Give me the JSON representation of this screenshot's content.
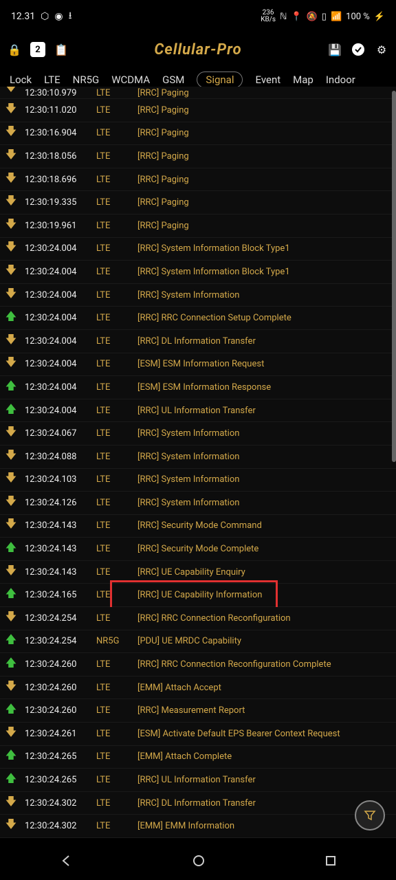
{
  "status": {
    "time": "12.31",
    "kbs_top": "236",
    "kbs_bot": "KB/s",
    "battery": "100 %"
  },
  "app": {
    "title": "Cellular-Pro",
    "badge": "2"
  },
  "tabs": [
    "Lock",
    "LTE",
    "NR5G",
    "WCDMA",
    "GSM",
    "Signal",
    "Event",
    "Map",
    "Indoor"
  ],
  "active_tab": "Signal",
  "log": [
    {
      "dir": "down",
      "time": "12:30:10.979",
      "tech": "LTE",
      "msg": "[RRC] Paging",
      "partial": true
    },
    {
      "dir": "down",
      "time": "12:30:11.020",
      "tech": "LTE",
      "msg": "[RRC] Paging"
    },
    {
      "dir": "down",
      "time": "12:30:16.904",
      "tech": "LTE",
      "msg": "[RRC] Paging"
    },
    {
      "dir": "down",
      "time": "12:30:18.056",
      "tech": "LTE",
      "msg": "[RRC] Paging"
    },
    {
      "dir": "down",
      "time": "12:30:18.696",
      "tech": "LTE",
      "msg": "[RRC] Paging"
    },
    {
      "dir": "down",
      "time": "12:30:19.335",
      "tech": "LTE",
      "msg": "[RRC] Paging"
    },
    {
      "dir": "down",
      "time": "12:30:19.961",
      "tech": "LTE",
      "msg": "[RRC] Paging"
    },
    {
      "dir": "down",
      "time": "12:30:24.004",
      "tech": "LTE",
      "msg": "[RRC] System Information Block Type1"
    },
    {
      "dir": "down",
      "time": "12:30:24.004",
      "tech": "LTE",
      "msg": "[RRC] System Information Block Type1"
    },
    {
      "dir": "down",
      "time": "12:30:24.004",
      "tech": "LTE",
      "msg": "[RRC] System Information"
    },
    {
      "dir": "up",
      "time": "12:30:24.004",
      "tech": "LTE",
      "msg": "[RRC] RRC Connection Setup Complete"
    },
    {
      "dir": "down",
      "time": "12:30:24.004",
      "tech": "LTE",
      "msg": "[RRC] DL Information Transfer"
    },
    {
      "dir": "down",
      "time": "12:30:24.004",
      "tech": "LTE",
      "msg": "[ESM] ESM Information Request"
    },
    {
      "dir": "up",
      "time": "12:30:24.004",
      "tech": "LTE",
      "msg": "[ESM] ESM Information Response"
    },
    {
      "dir": "up",
      "time": "12:30:24.004",
      "tech": "LTE",
      "msg": "[RRC] UL Information Transfer"
    },
    {
      "dir": "down",
      "time": "12:30:24.067",
      "tech": "LTE",
      "msg": "[RRC] System Information"
    },
    {
      "dir": "down",
      "time": "12:30:24.088",
      "tech": "LTE",
      "msg": "[RRC] System Information"
    },
    {
      "dir": "down",
      "time": "12:30:24.103",
      "tech": "LTE",
      "msg": "[RRC] System Information"
    },
    {
      "dir": "down",
      "time": "12:30:24.126",
      "tech": "LTE",
      "msg": "[RRC] System Information"
    },
    {
      "dir": "down",
      "time": "12:30:24.143",
      "tech": "LTE",
      "msg": "[RRC] Security Mode Command"
    },
    {
      "dir": "up",
      "time": "12:30:24.143",
      "tech": "LTE",
      "msg": "[RRC] Security Mode Complete"
    },
    {
      "dir": "down",
      "time": "12:30:24.143",
      "tech": "LTE",
      "msg": "[RRC] UE Capability Enquiry"
    },
    {
      "dir": "up",
      "time": "12:30:24.165",
      "tech": "LTE",
      "msg": "[RRC] UE Capability Information",
      "highlight": true
    },
    {
      "dir": "down",
      "time": "12:30:24.254",
      "tech": "LTE",
      "msg": "[RRC] RRC Connection Reconfiguration"
    },
    {
      "dir": "up",
      "time": "12:30:24.254",
      "tech": "NR5G",
      "msg": "[PDU] UE MRDC Capability"
    },
    {
      "dir": "up",
      "time": "12:30:24.260",
      "tech": "LTE",
      "msg": "[RRC] RRC Connection Reconfiguration Complete"
    },
    {
      "dir": "down",
      "time": "12:30:24.260",
      "tech": "LTE",
      "msg": "[EMM] Attach Accept"
    },
    {
      "dir": "up",
      "time": "12:30:24.260",
      "tech": "LTE",
      "msg": "[RRC] Measurement Report"
    },
    {
      "dir": "down",
      "time": "12:30:24.261",
      "tech": "LTE",
      "msg": "[ESM] Activate Default EPS Bearer Context Request"
    },
    {
      "dir": "up",
      "time": "12:30:24.265",
      "tech": "LTE",
      "msg": "[EMM] Attach Complete"
    },
    {
      "dir": "up",
      "time": "12:30:24.265",
      "tech": "LTE",
      "msg": "[RRC] UL Information Transfer"
    },
    {
      "dir": "down",
      "time": "12:30:24.302",
      "tech": "LTE",
      "msg": "[RRC] DL Information Transfer"
    },
    {
      "dir": "down",
      "time": "12:30:24.302",
      "tech": "LTE",
      "msg": "[EMM] EMM Information"
    }
  ]
}
